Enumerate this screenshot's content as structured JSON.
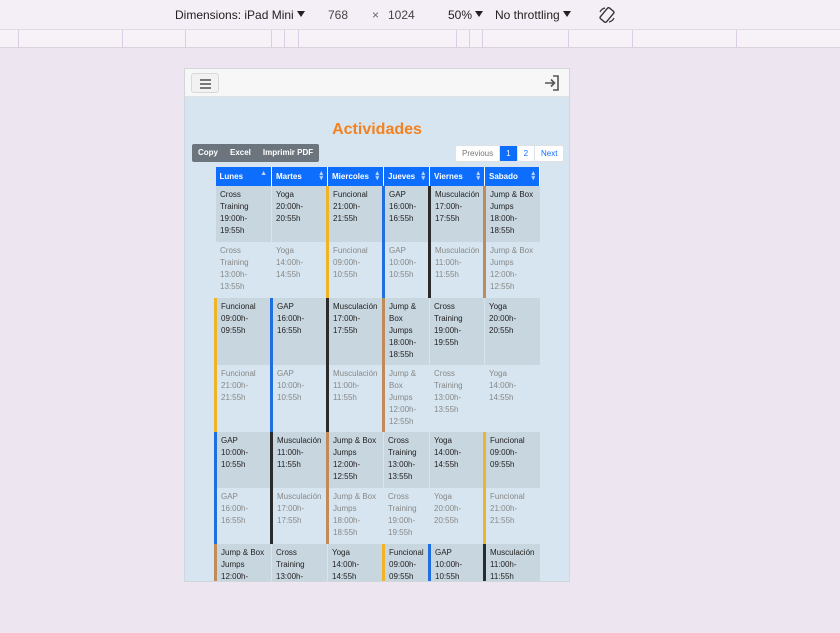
{
  "devtools": {
    "dimensions_label": "Dimensions: iPad Mini",
    "width_value": "768",
    "times": "×",
    "height_value": "1024",
    "zoom": "50%",
    "throttling": "No throttling",
    "rotate_icon": "rotate-icon"
  },
  "app": {
    "menu_icon": "hamburger-menu-icon",
    "login_icon": "login-icon",
    "title": "Actividades",
    "export_buttons": [
      "Copy",
      "Excel",
      "Imprimir PDF"
    ],
    "pagination": {
      "previous": "Previous",
      "pages": [
        "1",
        "2"
      ],
      "active_page": "1",
      "next": "Next"
    },
    "colors": {
      "title": "#f4811f",
      "header": "#0d6efd",
      "yellow": "#f0b429",
      "blue": "#1f6fe0",
      "black": "#2b2b2b",
      "brown": "#c08a5a"
    },
    "columns": [
      "Lunes",
      "Martes",
      "Miercoles",
      "Jueves",
      "Viernes",
      "Sabado"
    ],
    "rows": [
      [
        {
          "a": "Cross Training",
          "t": "19:00h-19:55h",
          "c": "none"
        },
        {
          "a": "Yoga",
          "t": "20:00h-20:55h",
          "c": "none"
        },
        {
          "a": "Funcional",
          "t": "21:00h-21:55h",
          "c": "yellow"
        },
        {
          "a": "GAP",
          "t": "16:00h-16:55h",
          "c": "blue"
        },
        {
          "a": "Musculación",
          "t": "17:00h-17:55h",
          "c": "black"
        },
        {
          "a": "Jump & Box Jumps",
          "t": "18:00h-18:55h",
          "c": "brown"
        }
      ],
      [
        {
          "a": "Cross Training",
          "t": "13:00h-13:55h",
          "c": "none"
        },
        {
          "a": "Yoga",
          "t": "14:00h-14:55h",
          "c": "none"
        },
        {
          "a": "Funcional",
          "t": "09:00h-10:55h",
          "c": "yellow"
        },
        {
          "a": "GAP",
          "t": "10:00h-10:55h",
          "c": "blue"
        },
        {
          "a": "Musculación",
          "t": "11:00h-11:55h",
          "c": "black"
        },
        {
          "a": "Jump & Box Jumps",
          "t": "12:00h-12:55h",
          "c": "brown"
        }
      ],
      [
        {
          "a": "Funcional",
          "t": "09:00h-09:55h",
          "c": "yellow"
        },
        {
          "a": "GAP",
          "t": "16:00h-16:55h",
          "c": "blue"
        },
        {
          "a": "Musculación",
          "t": "17:00h-17:55h",
          "c": "black"
        },
        {
          "a": "Jump & Box Jumps",
          "t": "18:00h-18:55h",
          "c": "brown"
        },
        {
          "a": "Cross Training",
          "t": "19:00h-19:55h",
          "c": "none"
        },
        {
          "a": "Yoga",
          "t": "20:00h-20:55h",
          "c": "none"
        }
      ],
      [
        {
          "a": "Funcional",
          "t": "21:00h-21:55h",
          "c": "yellow"
        },
        {
          "a": "GAP",
          "t": "10:00h-10:55h",
          "c": "blue"
        },
        {
          "a": "Musculación",
          "t": "11:00h-11:55h",
          "c": "black"
        },
        {
          "a": "Jump & Box Jumps",
          "t": "12:00h-12:55h",
          "c": "brown"
        },
        {
          "a": "Cross Training",
          "t": "13:00h-13:55h",
          "c": "none"
        },
        {
          "a": "Yoga",
          "t": "14:00h-14:55h",
          "c": "none"
        }
      ],
      [
        {
          "a": "GAP",
          "t": "10:00h-10:55h",
          "c": "blue"
        },
        {
          "a": "Musculación",
          "t": "11:00h-11:55h",
          "c": "black"
        },
        {
          "a": "Jump & Box Jumps",
          "t": "12:00h-12:55h",
          "c": "brown"
        },
        {
          "a": "Cross Training",
          "t": "13:00h-13:55h",
          "c": "none"
        },
        {
          "a": "Yoga",
          "t": "14:00h-14:55h",
          "c": "none"
        },
        {
          "a": "Funcional",
          "t": "09:00h-09:55h",
          "c": "yellow"
        }
      ],
      [
        {
          "a": "GAP",
          "t": "16:00h-16:55h",
          "c": "blue"
        },
        {
          "a": "Musculación",
          "t": "17:00h-17:55h",
          "c": "black"
        },
        {
          "a": "Jump & Box Jumps",
          "t": "18:00h-18:55h",
          "c": "brown"
        },
        {
          "a": "Cross Training",
          "t": "19:00h-19:55h",
          "c": "none"
        },
        {
          "a": "Yoga",
          "t": "20:00h-20:55h",
          "c": "none"
        },
        {
          "a": "Funcional",
          "t": "21:00h-21:55h",
          "c": "yellow"
        }
      ],
      [
        {
          "a": "Jump & Box Jumps",
          "t": "12:00h-",
          "c": "brown"
        },
        {
          "a": "Cross Training",
          "t": "13:00h-",
          "c": "none"
        },
        {
          "a": "Yoga",
          "t": "14:00h-14:55h",
          "c": "none"
        },
        {
          "a": "Funcional",
          "t": "09:00h-09:55h",
          "c": "yellow"
        },
        {
          "a": "GAP",
          "t": "10:00h-10:55h",
          "c": "blue"
        },
        {
          "a": "Musculación",
          "t": "11:00h-11:55h",
          "c": "black"
        }
      ]
    ]
  }
}
